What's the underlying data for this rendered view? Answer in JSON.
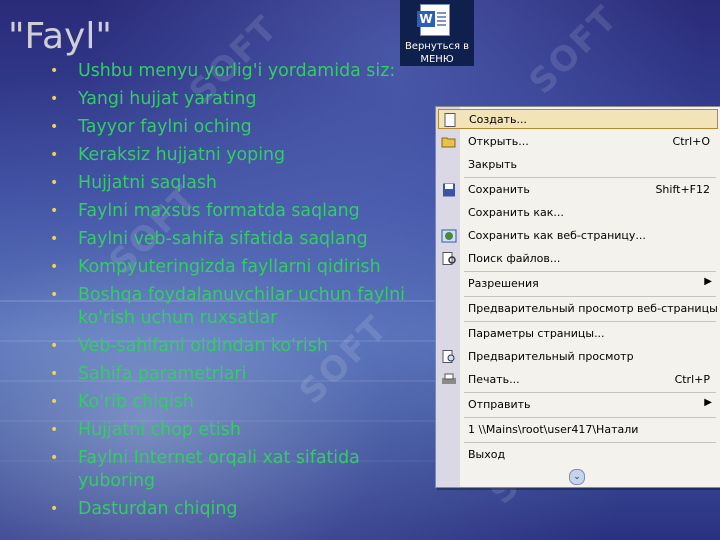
{
  "slide": {
    "title": "\"Fayl\"",
    "watermark": "SOFT",
    "bullets": [
      "Ushbu menyu yorlig'i yordamida siz:",
      "Yangi hujjat yarating",
      "Tayyor faylni oching",
      "Keraksiz hujjatni yoping",
      "Hujjatni saqlash",
      "Faylni maxsus formatda saqlang",
      "Faylni veb-sahifa sifatida saqlang",
      "Kompyuteringizda fayllarni qidirish",
      "Boshqa foydalanuvchilar uchun faylni ko'rish uchun ruxsatlar",
      "Veb-sahifani oldindan ko'rish",
      "Sahifa parametrlari",
      "Ko'rib chiqish",
      "Hujjatni chop etish",
      "Faylni Internet orqali xat sifatida yuboring",
      "Dasturdan chiqing"
    ],
    "bullet_color": "#33cc66",
    "bullet_marker_color": "#e5d84a"
  },
  "desktop_icon": {
    "label": "Вернуться в МЕНЮ",
    "glyph": "W"
  },
  "file_menu": {
    "items": [
      {
        "label": "Создать...",
        "shortcut": "",
        "icon": "new-document-icon"
      },
      {
        "label": "Открыть...",
        "shortcut": "Ctrl+O",
        "icon": "open-folder-icon"
      },
      {
        "label": "Закрыть",
        "shortcut": "",
        "icon": ""
      },
      {
        "label": "Сохранить",
        "shortcut": "Shift+F12",
        "icon": "save-disk-icon"
      },
      {
        "label": "Сохранить как...",
        "shortcut": "",
        "icon": ""
      },
      {
        "label": "Сохранить как веб-страницу...",
        "shortcut": "",
        "icon": "web-page-icon"
      },
      {
        "label": "Поиск файлов...",
        "shortcut": "",
        "icon": "file-search-icon"
      },
      {
        "label": "Разрешения",
        "shortcut": "",
        "icon": ""
      },
      {
        "label": "Предварительный просмотр веб-страницы",
        "shortcut": "",
        "icon": ""
      },
      {
        "label": "Параметры страницы...",
        "shortcut": "",
        "icon": ""
      },
      {
        "label": "Предварительный просмотр",
        "shortcut": "",
        "icon": "print-preview-icon"
      },
      {
        "label": "Печать...",
        "shortcut": "Ctrl+P",
        "icon": "printer-icon"
      },
      {
        "label": "Отправить",
        "shortcut": "",
        "icon": ""
      },
      {
        "label": "1 \\\\Mains\\root\\user417\\Натали",
        "shortcut": "",
        "icon": ""
      },
      {
        "label": "Выход",
        "shortcut": "",
        "icon": ""
      }
    ],
    "highlight_color": "#f3e3b8"
  }
}
